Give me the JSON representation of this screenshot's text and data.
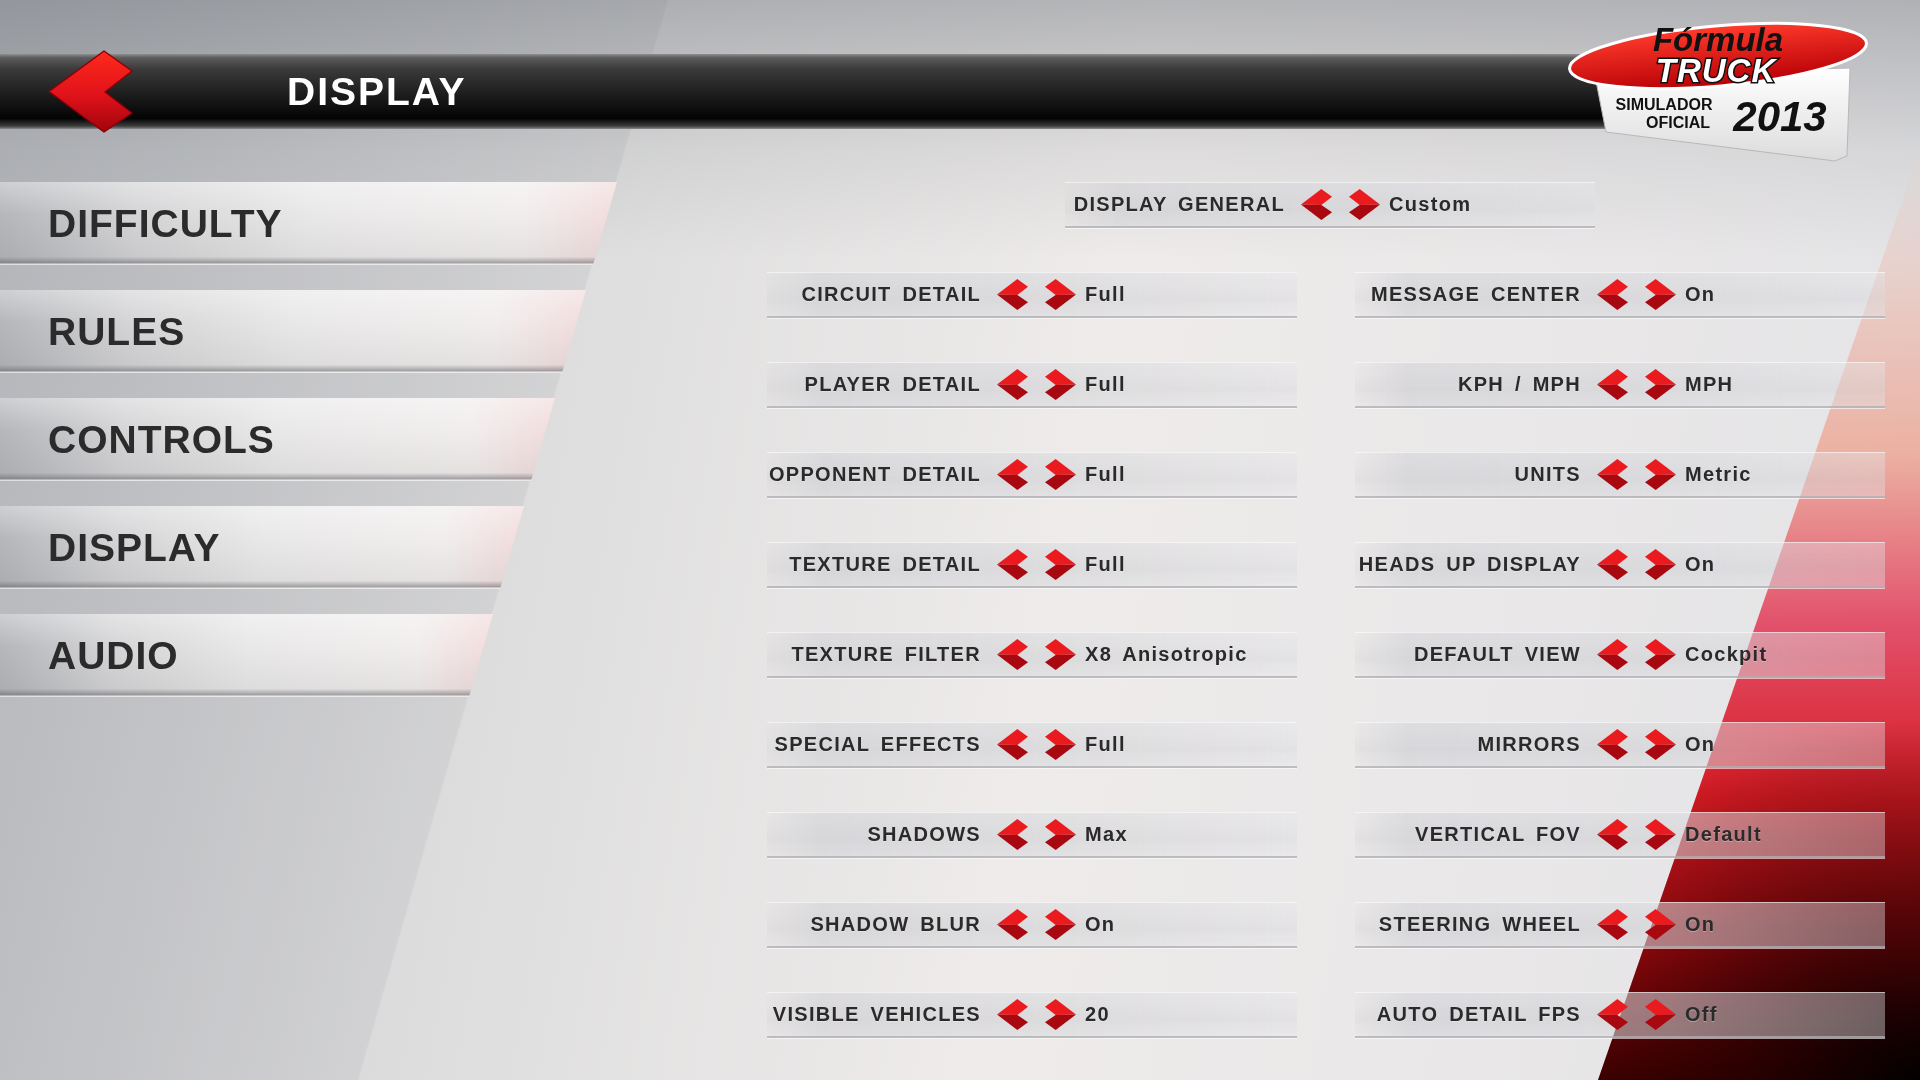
{
  "header": {
    "title": "DISPLAY"
  },
  "logo": {
    "wordmark": "Fórmula",
    "name": "TRUCK",
    "tagline": [
      "SIMULADOR",
      "OFICIAL"
    ],
    "year": "2013"
  },
  "sidebar": {
    "items": [
      {
        "label": "DIFFICULTY"
      },
      {
        "label": "RULES"
      },
      {
        "label": "CONTROLS"
      },
      {
        "label": "DISPLAY"
      },
      {
        "label": "AUDIO"
      }
    ]
  },
  "general": {
    "label": "DISPLAY GENERAL",
    "value": "Custom"
  },
  "settings_left": [
    {
      "label": "CIRCUIT DETAIL",
      "value": "Full"
    },
    {
      "label": "PLAYER DETAIL",
      "value": "Full"
    },
    {
      "label": "OPPONENT DETAIL",
      "value": "Full"
    },
    {
      "label": "TEXTURE DETAIL",
      "value": "Full"
    },
    {
      "label": "TEXTURE FILTER",
      "value": "X8 Anisotropic"
    },
    {
      "label": "SPECIAL EFFECTS",
      "value": "Full"
    },
    {
      "label": "SHADOWS",
      "value": "Max"
    },
    {
      "label": "SHADOW BLUR",
      "value": "On"
    },
    {
      "label": "VISIBLE VEHICLES",
      "value": "20"
    }
  ],
  "settings_right": [
    {
      "label": "MESSAGE CENTER",
      "value": "On"
    },
    {
      "label": "KPH / MPH",
      "value": "MPH"
    },
    {
      "label": "UNITS",
      "value": "Metric"
    },
    {
      "label": "HEADS UP DISPLAY",
      "value": "On"
    },
    {
      "label": "DEFAULT VIEW",
      "value": "Cockpit"
    },
    {
      "label": "MIRRORS",
      "value": "On"
    },
    {
      "label": "VERTICAL FOV",
      "value": "Default"
    },
    {
      "label": "STEERING WHEEL",
      "value": "On"
    },
    {
      "label": "AUTO DETAIL FPS",
      "value": "Off"
    }
  ]
}
